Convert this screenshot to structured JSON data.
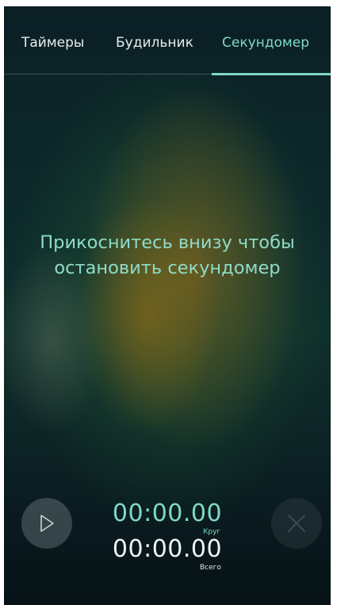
{
  "tabs": [
    {
      "label": "Таймеры",
      "active": false
    },
    {
      "label": "Будильник",
      "active": false
    },
    {
      "label": "Секундомер",
      "active": true
    }
  ],
  "hint": {
    "line1": "Прикоснитесь внизу чтобы",
    "line2": "остановить секундомер"
  },
  "stopwatch": {
    "lap_time": "00:00.00",
    "lap_label": "Круг",
    "total_time": "00:00.00",
    "total_label": "Всего"
  },
  "controls": {
    "play_icon": "play-icon",
    "reset_icon": "close-icon"
  },
  "colors": {
    "accent": "#7fd9c6",
    "text": "#e6eeee"
  }
}
